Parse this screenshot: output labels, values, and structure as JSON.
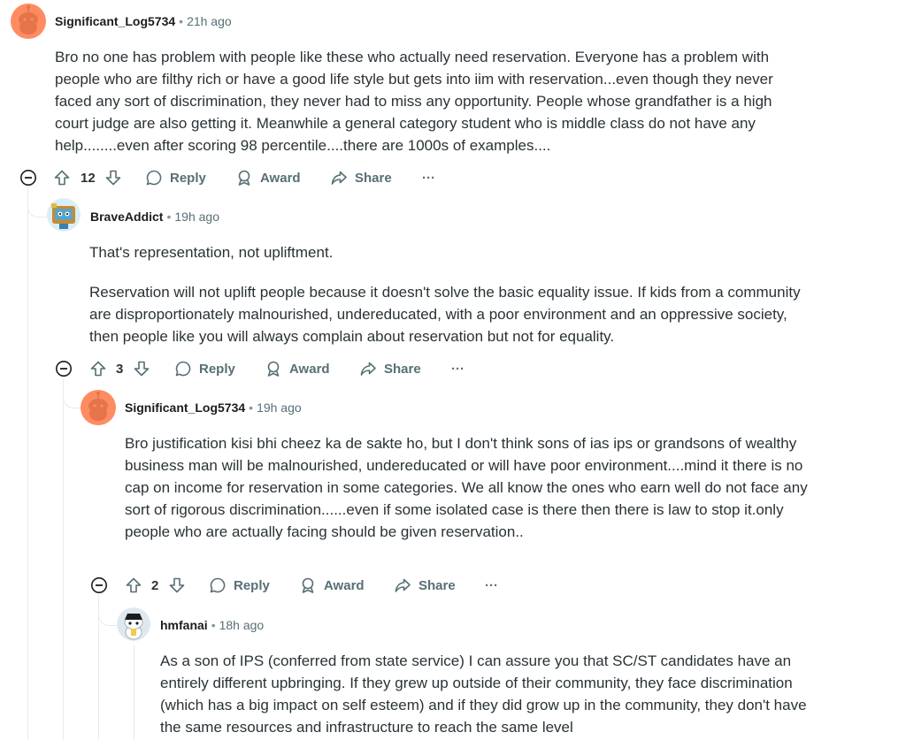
{
  "comments": [
    {
      "username": "Significant_Log5734",
      "time": "21h ago",
      "body": [
        "Bro no one has problem with people like these who actually need reservation. Everyone has a problem with people who are filthy rich or have a good life style but gets into iim with reservation...even though they never faced any sort of discrimination, they never had to miss any opportunity. People whose grandfather is a high court judge are also getting it. Meanwhile a general category student who is middle class do not have any help........even after scoring 98 percentile....there are 1000s of examples...."
      ],
      "votes": "12"
    },
    {
      "username": "BraveAddict",
      "time": "19h ago",
      "body": [
        "That's representation, not upliftment.",
        "Reservation will not uplift people because it doesn't solve the basic equality issue. If kids from a community are disproportionately malnourished, undereducated, with a poor environment and an oppressive society, then people like you will always complain about reservation but not for equality."
      ],
      "votes": "3"
    },
    {
      "username": "Significant_Log5734",
      "time": "19h ago",
      "body": [
        "Bro justification kisi bhi cheez ka de sakte ho, but I don't think sons of ias ips or grandsons of wealthy business man will be malnourished, undereducated or will have poor environment....mind it there is no cap on income for reservation in some categories. We all know the ones who earn well do not face any sort of rigorous discrimination......even if some isolated case is there then there is law to stop it.only people who are actually facing should be given reservation.."
      ],
      "votes": "2"
    },
    {
      "username": "hmfanai",
      "time": "18h ago",
      "body": [
        "As a son of IPS (conferred from state service) I can assure you that SC/ST candidates have an entirely different upbringing. If they grew up outside of their community, they face discrimination (which has a big impact on self esteem) and if they did grow up in the community, they don't have the same resources and infrastructure to reach the same level"
      ]
    }
  ],
  "labels": {
    "reply": "Reply",
    "award": "Award",
    "share": "Share",
    "more": "···",
    "dot": "•"
  },
  "colors": {
    "avatar_orange": "#ff8b60",
    "thread_line": "#e5ebee",
    "meta_gray": "#576f76"
  }
}
